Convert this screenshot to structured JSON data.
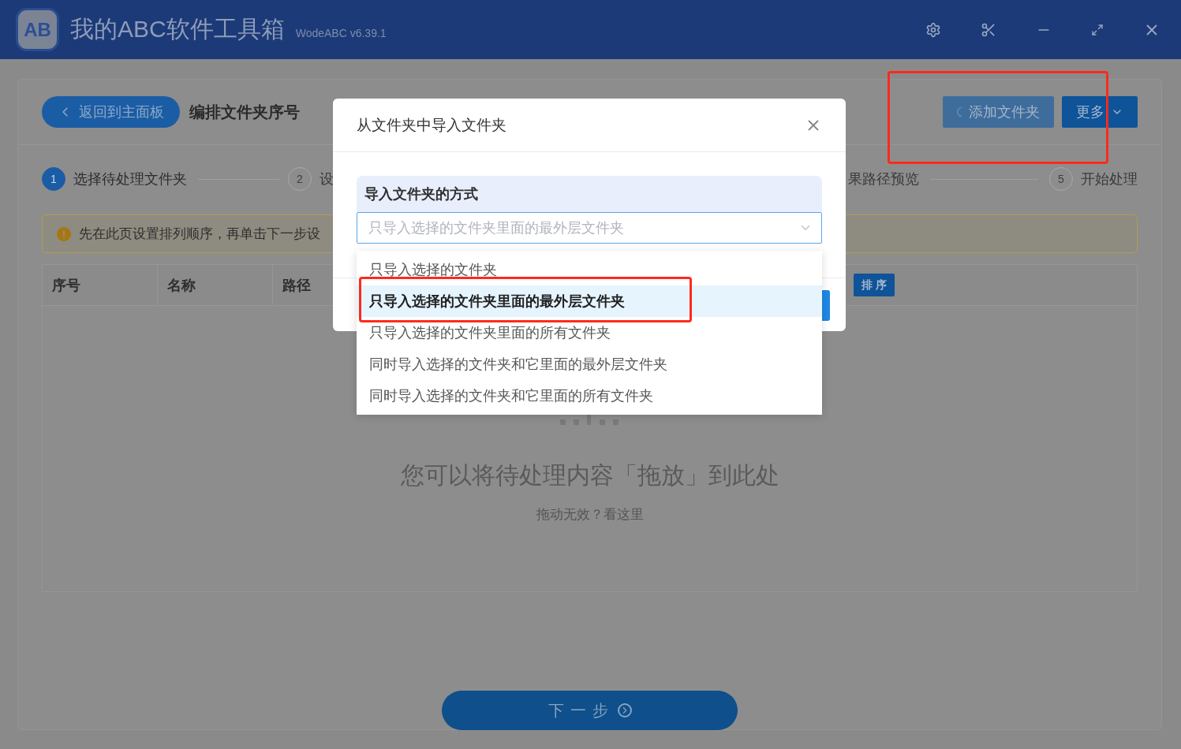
{
  "window": {
    "logo_text": "AB",
    "title": "我的ABC软件工具箱",
    "version": "WodeABC v6.39.1"
  },
  "header": {
    "back_button": "返回到主面板",
    "page_title": "编排文件夹序号",
    "highlighted": true,
    "buttons": [
      {
        "label": "添加文件夹",
        "kind": "loading"
      },
      {
        "label": "更多",
        "kind": "menu"
      }
    ]
  },
  "steps": [
    {
      "number": "1",
      "label": "选择待处理文件夹",
      "selected": true
    },
    {
      "number": "2",
      "label": "设",
      "selected": false
    },
    {
      "label": "果路径预览",
      "selected": false
    },
    {
      "number": "5",
      "label": "开始处理",
      "selected": false
    }
  ],
  "notice": "先在此页设置排列顺序，再单击下一步设",
  "table": {
    "columns": [
      "序号",
      "名称",
      "路径"
    ],
    "sort_button": "排 序"
  },
  "empty_state": {
    "title": "您可以将待处理内容「拖放」到此处",
    "link": "拖动无效？看这里"
  },
  "next_button": "下一步",
  "dialog": {
    "title": "从文件夹中导入文件夹",
    "section_label": "导入文件夹的方式",
    "select": {
      "placeholder": "只导入选择的文件夹里面的最外层文件夹",
      "expanded": true
    },
    "options": [
      {
        "label": "只导入选择的文件夹",
        "selected": false,
        "highlighted": false
      },
      {
        "label": "只导入选择的文件夹里面的最外层文件夹",
        "selected": true,
        "highlighted": true
      },
      {
        "label": "只导入选择的文件夹里面的所有文件夹",
        "selected": false,
        "highlighted": false
      },
      {
        "label": "同时导入选择的文件夹和它里面的最外层文件夹",
        "selected": false,
        "highlighted": false
      },
      {
        "label": "同时导入选择的文件夹和它里面的所有文件夹",
        "selected": false,
        "highlighted": false
      }
    ]
  }
}
